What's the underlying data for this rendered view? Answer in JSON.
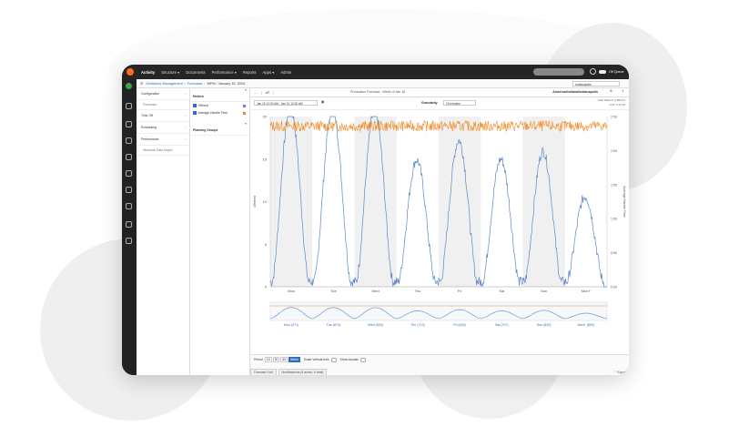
{
  "nav": {
    "items": [
      "Activity",
      "Structure ▾",
      "Documents",
      "Performance ▾",
      "Reports",
      "Apps ▾",
      "Admin"
    ],
    "off_queue_label": "Off Queue"
  },
  "breadcrumb": {
    "items": [
      "Workforce Management",
      "Forecasts"
    ],
    "current": "WFM / January 15, 2024"
  },
  "site_select": "Indianapolis",
  "sidebar": {
    "items": [
      "Configuration",
      "Forecasts",
      "Time Off",
      "Scheduling",
      "Performance",
      "Historical Data Import"
    ]
  },
  "metrics_panel": {
    "title": "Metrics",
    "rows": [
      "Offered",
      "Average Handle Time"
    ],
    "planning_groups_title": "Planning Groups"
  },
  "tabs": {
    "tab1": "AP",
    "forecast_title": "Production Forecast - Week of Jan 15",
    "timezone": "America/Indiana/Indianapolis"
  },
  "controls": {
    "date_range": "Jan 15 12:00 AM - Jan 21 12:00 AM",
    "granularity_label": "Granularity",
    "granularity_value": "15 minutes",
    "total_offered": "Total Offered: 6,800.41",
    "aht": "AHT: 2:22.18"
  },
  "footer": {
    "period_label": "Period",
    "period_buttons": [
      "15",
      "30",
      "60",
      "Week"
    ],
    "scale_label": "Scale Vertical Axis",
    "show_actuals_label": "Show Actuals",
    "tabs": [
      "Forecast Grid",
      "Modifications (5 active, 5 total)"
    ],
    "export_label": "⌃ Export"
  },
  "colors": {
    "offered": "#5b87c9",
    "aht": "#f08a24",
    "accent": "#2f6ebf"
  },
  "chart_data": {
    "type": "line",
    "categories": [
      "Mon",
      "Tue",
      "Wed",
      "Thu",
      "Fri",
      "Sat",
      "Sun",
      "Mon+"
    ],
    "navigator_labels": [
      "Mon (971)",
      "Tue (874)",
      "Wed (920)",
      "Thu (713)",
      "Fri (830)",
      "Sat (707)",
      "Sun (642)",
      "Mon+ (800)"
    ],
    "ylabel": "Offered",
    "y2label": "Average Handle Time",
    "ylim": [
      0,
      20
    ],
    "y2lim": [
      0,
      2.5
    ],
    "yticks": [
      0,
      5,
      10,
      15,
      20
    ],
    "y2ticks": [
      "0:00",
      "0:50",
      "1:00",
      "1:50",
      "2:00",
      "2:50"
    ],
    "series": [
      {
        "name": "Offered",
        "axis": "left",
        "daily_peak": [
          20.5,
          20.3,
          20.2,
          14.3,
          16.6,
          14.4,
          15.3,
          10
        ]
      },
      {
        "name": "Average Handle Time",
        "axis": "right",
        "mean": 2.36
      }
    ]
  }
}
